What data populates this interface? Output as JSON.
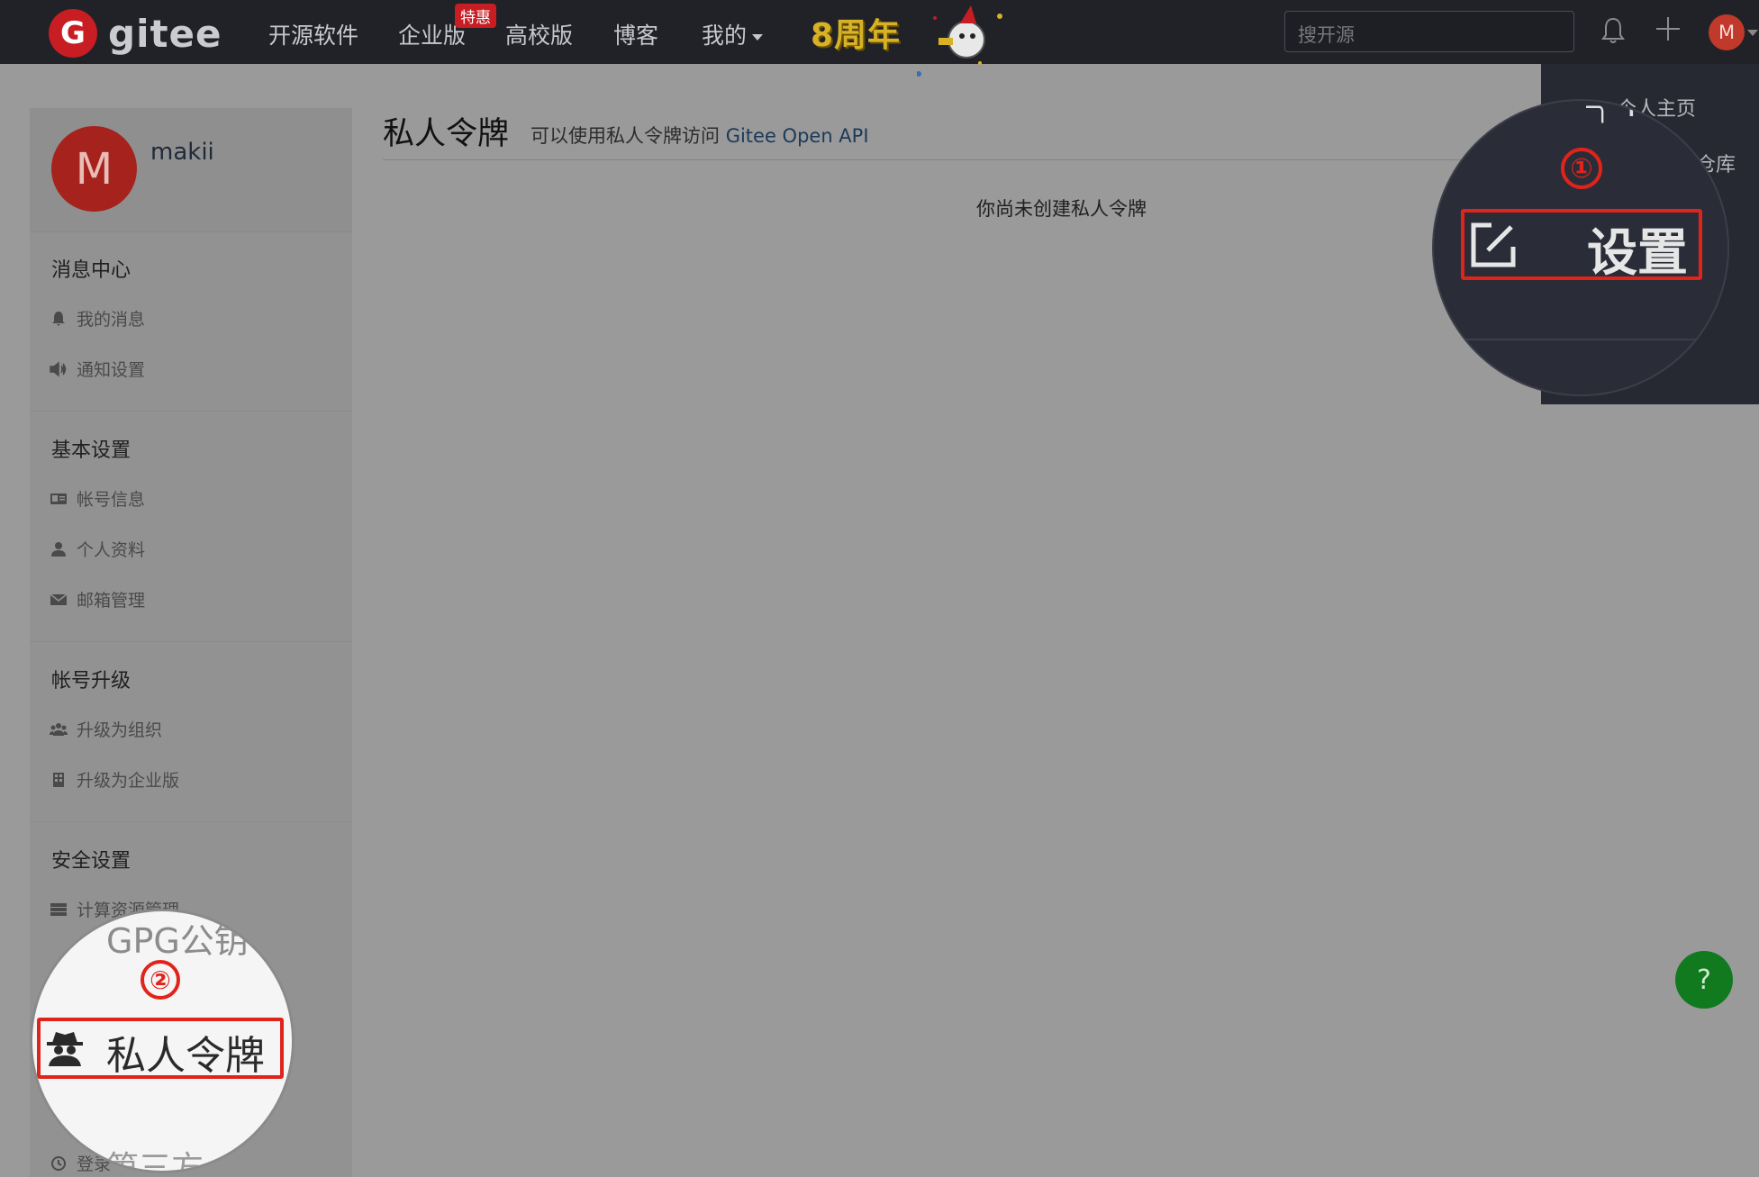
{
  "nav": {
    "logo_letter": "G",
    "logo_text": "gitee",
    "items": [
      "开源软件",
      "企业版",
      "高校版",
      "博客",
      "我的"
    ],
    "badge": "特惠",
    "anniversary": "8周年",
    "search_placeholder": "搜开源",
    "avatar_letter": "M"
  },
  "dropdown": {
    "items": [
      "个人主页",
      "仓库"
    ]
  },
  "sidebar": {
    "avatar_letter": "M",
    "username": "makii",
    "sections": [
      {
        "title": "消息中心",
        "items": [
          "我的消息",
          "通知设置"
        ]
      },
      {
        "title": "基本设置",
        "items": [
          "帐号信息",
          "个人资料",
          "邮箱管理"
        ]
      },
      {
        "title": "帐号升级",
        "items": [
          "升级为组织",
          "升级为企业版"
        ]
      },
      {
        "title": "安全设置",
        "items": [
          "计算资源管理",
          "登录"
        ]
      }
    ]
  },
  "main": {
    "title": "私人令牌",
    "subtitle": "可以使用私人令牌访问",
    "subtitle_link": "Gitee Open API",
    "empty_message": "你尚未创建私人令牌"
  },
  "help": "?",
  "callouts": {
    "step1_num": "①",
    "step1_label": "设置",
    "step2_num": "②",
    "step2_label": "私人令牌",
    "step2_fragment_top": "GPG公钥",
    "step2_fragment_bottom": "第三方"
  },
  "colors": {
    "brand": "#c71d23",
    "highlight": "#e0231b",
    "help": "#117a1e"
  }
}
